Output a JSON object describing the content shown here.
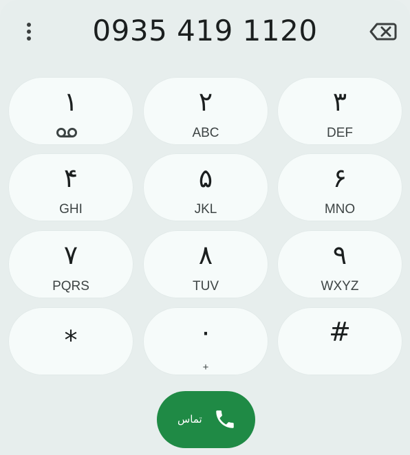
{
  "header": {
    "phone_number": "0935 419 1120",
    "more_icon": "more-vert-icon",
    "backspace_icon": "backspace-icon"
  },
  "keypad": {
    "keys": [
      {
        "digit": "۱",
        "letters": "",
        "icon": "voicemail-icon"
      },
      {
        "digit": "۲",
        "letters": "ABC"
      },
      {
        "digit": "۳",
        "letters": "DEF"
      },
      {
        "digit": "۴",
        "letters": "GHI"
      },
      {
        "digit": "۵",
        "letters": "JKL"
      },
      {
        "digit": "۶",
        "letters": "MNO"
      },
      {
        "digit": "۷",
        "letters": "PQRS"
      },
      {
        "digit": "۸",
        "letters": "TUV"
      },
      {
        "digit": "۹",
        "letters": "WXYZ"
      },
      {
        "digit": "*",
        "letters": ""
      },
      {
        "digit": "۰",
        "letters": "+"
      },
      {
        "digit": "#",
        "letters": ""
      }
    ]
  },
  "call": {
    "label": "تماس",
    "icon": "phone-icon"
  },
  "colors": {
    "background": "#e7eeed",
    "key": "#f6fbfa",
    "call_button": "#1f8a45",
    "text": "#1b1f1f"
  }
}
